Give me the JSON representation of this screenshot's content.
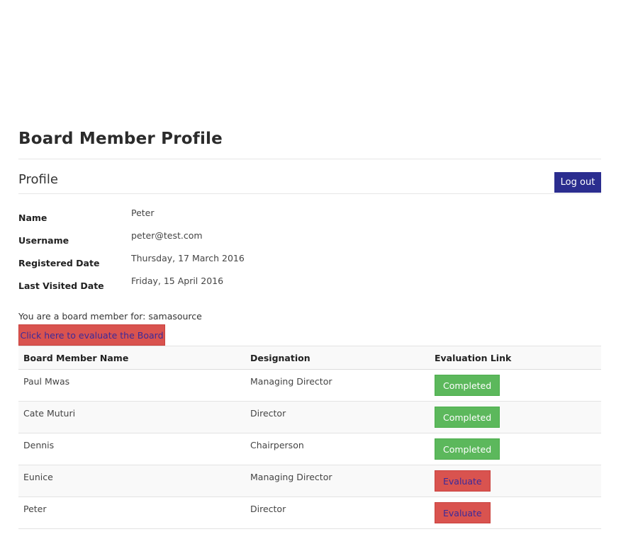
{
  "header": {
    "title": "Board Member Profile",
    "subtitle": "Profile",
    "logout_label": "Log out"
  },
  "profile": {
    "fields": [
      {
        "label": "Name",
        "value": "Peter"
      },
      {
        "label": "Username",
        "value": "peter@test.com"
      },
      {
        "label": "Registered Date",
        "value": "Thursday, 17 March 2016"
      },
      {
        "label": "Last Visited Date",
        "value": "Friday, 15 April 2016"
      }
    ]
  },
  "membership": {
    "note": "You are a board member for: samasource",
    "evaluate_board_label": "Click here to evaluate the Board"
  },
  "table": {
    "headers": [
      "Board Member Name",
      "Designation",
      "Evaluation Link"
    ],
    "rows": [
      {
        "name": "Paul Mwas",
        "designation": "Managing Director",
        "status": "Completed"
      },
      {
        "name": "Cate Muturi",
        "designation": "Director",
        "status": "Completed"
      },
      {
        "name": "Dennis",
        "designation": "Chairperson",
        "status": "Completed"
      },
      {
        "name": "Eunice",
        "designation": "Managing Director",
        "status": "Evaluate"
      },
      {
        "name": "Peter",
        "designation": "Director",
        "status": "Evaluate"
      }
    ]
  },
  "colors": {
    "logout_bg": "#2b2d8f",
    "completed_bg": "#5cb85c",
    "evaluate_bg": "#d9534f",
    "evaluate_text": "#3b2a9a"
  }
}
